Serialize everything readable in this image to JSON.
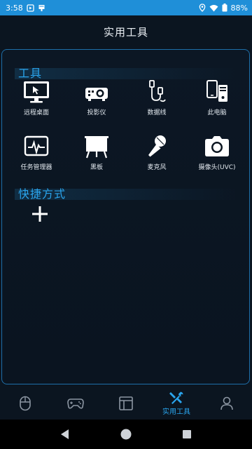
{
  "status_bar": {
    "time": "3:58",
    "battery": "88%",
    "icons": [
      "google-play-store-icon",
      "notification-icon",
      "location-icon",
      "wifi-icon",
      "battery-icon"
    ]
  },
  "header": {
    "title": "实用工具"
  },
  "tools_section": {
    "title": "工具",
    "items": [
      {
        "label": "远程桌面",
        "icon": "remote-desktop-icon"
      },
      {
        "label": "投影仪",
        "icon": "projector-icon"
      },
      {
        "label": "数据线",
        "icon": "data-cable-icon"
      },
      {
        "label": "此电脑",
        "icon": "this-pc-icon"
      },
      {
        "label": "任务管理器",
        "icon": "task-manager-icon"
      },
      {
        "label": "黑板",
        "icon": "blackboard-icon"
      },
      {
        "label": "麦克风",
        "icon": "microphone-icon"
      },
      {
        "label": "摄像头(UVC)",
        "icon": "camera-icon"
      }
    ]
  },
  "shortcut_section": {
    "title": "快捷方式",
    "add_icon": "plus-icon"
  },
  "bottom_nav": {
    "items": [
      {
        "icon": "mouse-icon",
        "label": ""
      },
      {
        "icon": "gamepad-icon",
        "label": ""
      },
      {
        "icon": "layout-icon",
        "label": ""
      },
      {
        "icon": "tools-icon",
        "label": "实用工具",
        "active": true
      },
      {
        "icon": "profile-icon",
        "label": ""
      }
    ]
  },
  "colors": {
    "status_bar": "#1f8fd8",
    "accent": "#2aa5ee",
    "background": "#0b1520",
    "panel_border": "#1e6fa9"
  }
}
